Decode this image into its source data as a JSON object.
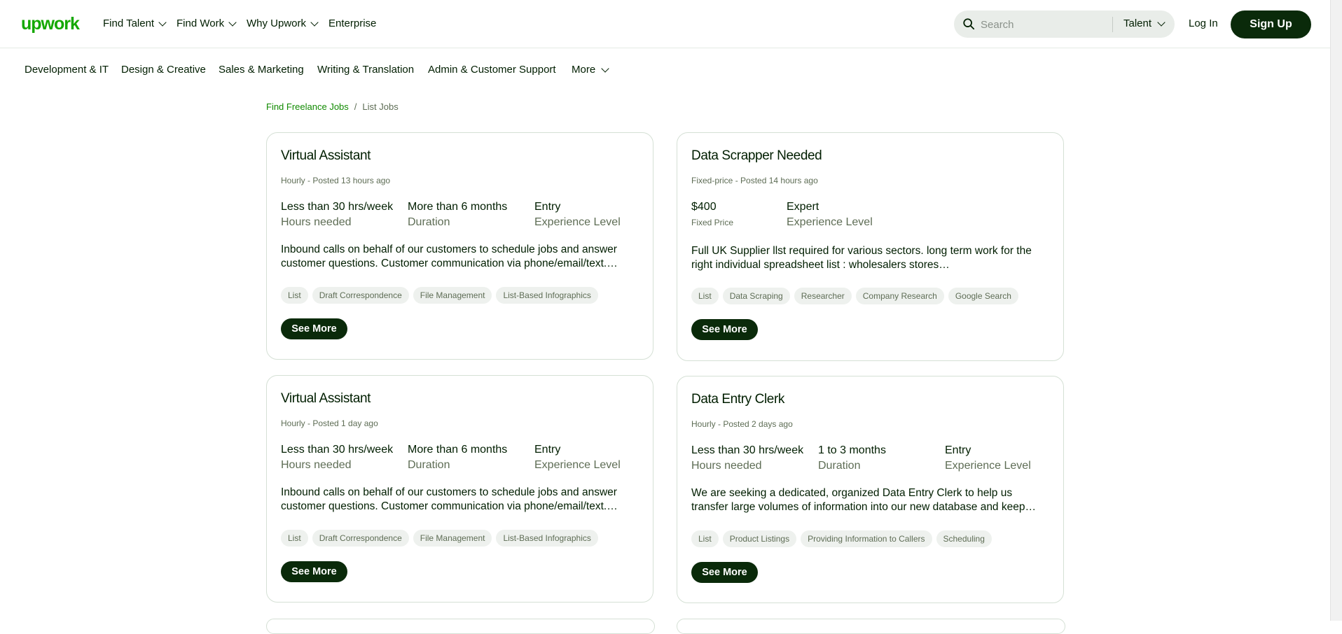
{
  "header": {
    "logo": "upwork",
    "nav": [
      "Find Talent",
      "Find Work",
      "Why Upwork",
      "Enterprise"
    ],
    "search_placeholder": "Search",
    "search_scope": "Talent",
    "login": "Log In",
    "signup": "Sign Up"
  },
  "categories": [
    "Development & IT",
    "Design & Creative",
    "Sales & Marketing",
    "Writing & Translation",
    "Admin & Customer Support"
  ],
  "more_label": "More",
  "breadcrumb": {
    "link": "Find Freelance Jobs",
    "separator": "/",
    "current": "List Jobs"
  },
  "see_more_label": "See More",
  "jobs": [
    {
      "title": "Virtual Assistant",
      "type": "Hourly",
      "posted": "Posted 13 hours ago",
      "stats": [
        {
          "value": "Less than 30 hrs/week",
          "label": "Hours needed"
        },
        {
          "value": "More than 6 months",
          "label": "Duration"
        },
        {
          "value": "Entry",
          "label": "Experience Level"
        }
      ],
      "description": "Inbound calls on behalf of our customers to schedule jobs and answer customer questions. Customer communication via phone/email/text.…",
      "tags": [
        "List",
        "Draft Correspondence",
        "File Management",
        "List-Based Infographics"
      ]
    },
    {
      "title": "Data Scrapper Needed",
      "type": "Fixed-price",
      "posted": "Posted 14 hours ago",
      "stats": [
        {
          "value": "$400",
          "label": "Fixed Price"
        },
        {
          "value": "Expert",
          "label": "Experience Level"
        }
      ],
      "description": "Full UK Supplier llst required for various sectors. long term work for the right individual spreadsheet list : wholesalers stores…",
      "tags": [
        "List",
        "Data Scraping",
        "Researcher",
        "Company Research",
        "Google Search"
      ]
    },
    {
      "title": "Virtual Assistant",
      "type": "Hourly",
      "posted": "Posted 1 day ago",
      "stats": [
        {
          "value": "Less than 30 hrs/week",
          "label": "Hours needed"
        },
        {
          "value": "More than 6 months",
          "label": "Duration"
        },
        {
          "value": "Entry",
          "label": "Experience Level"
        }
      ],
      "description": "Inbound calls on behalf of our customers to schedule jobs and answer customer questions. Customer communication via phone/email/text.…",
      "tags": [
        "List",
        "Draft Correspondence",
        "File Management",
        "List-Based Infographics"
      ]
    },
    {
      "title": "Data Entry Clerk",
      "type": "Hourly",
      "posted": "Posted 2 days ago",
      "stats": [
        {
          "value": "Less than 30 hrs/week",
          "label": "Hours needed"
        },
        {
          "value": "1 to 3 months",
          "label": "Duration"
        },
        {
          "value": "Entry",
          "label": "Experience Level"
        }
      ],
      "description": "We are seeking a dedicated, organized Data Entry Clerk to help us transfer large volumes of information into our new database and keep…",
      "tags": [
        "List",
        "Product Listings",
        "Providing Information to Callers",
        "Scheduling"
      ]
    }
  ],
  "colors": {
    "brand": "#14a800",
    "dark_button": "#0a2a0a",
    "link": "#108a00",
    "muted": "#5e6d55"
  }
}
